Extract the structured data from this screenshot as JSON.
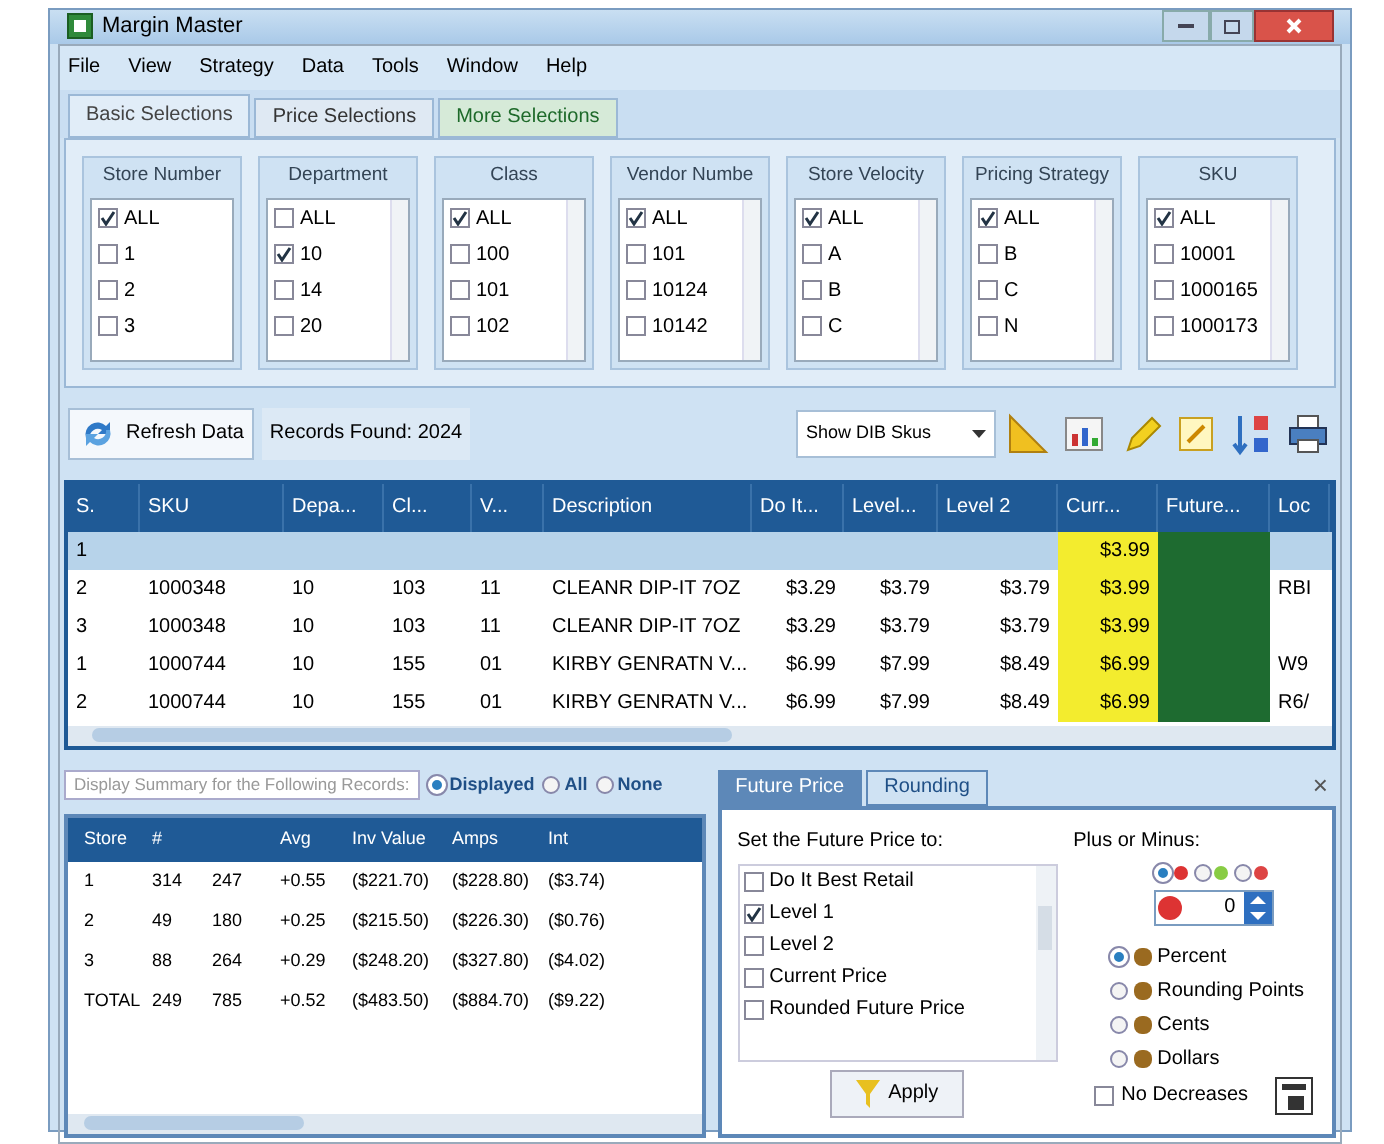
{
  "window": {
    "title": "Margin Master"
  },
  "menu": [
    "File",
    "View",
    "Strategy",
    "Data",
    "Tools",
    "Window",
    "Help"
  ],
  "tabs": [
    {
      "label": "Basic Selections",
      "selected": true
    },
    {
      "label": "Price Selections",
      "selected": false
    },
    {
      "label": "More Selections",
      "selected": false
    }
  ],
  "filters": [
    {
      "title": "Store Number",
      "items": [
        {
          "label": "ALL",
          "checked": true
        },
        {
          "label": "1",
          "checked": false
        },
        {
          "label": "2",
          "checked": false
        },
        {
          "label": "3",
          "checked": false
        }
      ]
    },
    {
      "title": "Department",
      "items": [
        {
          "label": "ALL",
          "checked": false
        },
        {
          "label": "10",
          "checked": true
        },
        {
          "label": "14",
          "checked": false
        },
        {
          "label": "20",
          "checked": false
        }
      ]
    },
    {
      "title": "Class",
      "items": [
        {
          "label": "ALL",
          "checked": true
        },
        {
          "label": "100",
          "checked": false
        },
        {
          "label": "101",
          "checked": false
        },
        {
          "label": "102",
          "checked": false
        }
      ]
    },
    {
      "title": "Vendor Numbe",
      "items": [
        {
          "label": "ALL",
          "checked": true
        },
        {
          "label": "101",
          "checked": false
        },
        {
          "label": "10124",
          "checked": false
        },
        {
          "label": "10142",
          "checked": false
        }
      ]
    },
    {
      "title": "Store Velocity",
      "items": [
        {
          "label": "ALL",
          "checked": true
        },
        {
          "label": "A",
          "checked": false
        },
        {
          "label": "B",
          "checked": false
        },
        {
          "label": "C",
          "checked": false
        }
      ]
    },
    {
      "title": "Pricing Strategy",
      "items": [
        {
          "label": "ALL",
          "checked": true
        },
        {
          "label": "B",
          "checked": false
        },
        {
          "label": "C",
          "checked": false
        },
        {
          "label": "N",
          "checked": false
        }
      ]
    },
    {
      "title": "SKU",
      "items": [
        {
          "label": "ALL",
          "checked": true
        },
        {
          "label": "10001",
          "checked": false
        },
        {
          "label": "1000165",
          "checked": false
        },
        {
          "label": "1000173",
          "checked": false
        }
      ]
    }
  ],
  "toolbar": {
    "refresh": "Refresh Data",
    "records": "Records Found: 2024",
    "dropdown": "Show DIB Skus"
  },
  "table": {
    "columns": [
      "S.",
      "SKU",
      "Depa...",
      "Cl...",
      "V...",
      "Description",
      "Do It...",
      "Level...",
      "Level 2",
      "Curr...",
      "Future...",
      "Loc"
    ],
    "rows": [
      {
        "selected": true,
        "cells": [
          "1",
          null,
          null,
          null,
          null,
          null,
          null,
          null,
          null,
          "$3.99",
          null,
          null
        ]
      },
      {
        "selected": false,
        "cells": [
          "2",
          "1000348",
          "10",
          "103",
          "11",
          "CLEANR DIP-IT 7OZ",
          "$3.29",
          "$3.79",
          "$3.79",
          "$3.99",
          null,
          "RBI"
        ]
      },
      {
        "selected": false,
        "cells": [
          "3",
          "1000348",
          "10",
          "103",
          "11",
          "CLEANR DIP-IT 7OZ",
          "$3.29",
          "$3.79",
          "$3.79",
          "$3.99",
          null,
          null
        ]
      },
      {
        "selected": false,
        "cells": [
          "1",
          "1000744",
          "10",
          "155",
          "01",
          "KIRBY GENRATN V...",
          "$6.99",
          "$7.99",
          "$8.49",
          "$6.99",
          null,
          "W9"
        ]
      },
      {
        "selected": false,
        "cells": [
          "2",
          "1000744",
          "10",
          "155",
          "01",
          "KIRBY GENRATN V...",
          "$6.99",
          "$7.99",
          "$8.49",
          "$6.99",
          null,
          "R6/"
        ]
      }
    ]
  },
  "summary": {
    "label": "Display Summary for the Following Records:",
    "options": [
      {
        "label": "Displayed",
        "selected": true
      },
      {
        "label": "All",
        "selected": false
      },
      {
        "label": "None",
        "selected": false
      }
    ],
    "columns": [
      "Store",
      "#",
      "",
      "Avg",
      "Inv Value",
      "Amps",
      "Int"
    ],
    "rows": [
      [
        "1",
        "314",
        "247",
        "+0.55",
        "($221.70)",
        "($228.80)",
        "($3.74)"
      ],
      [
        "2",
        "49",
        "180",
        "+0.25",
        "($215.50)",
        "($226.30)",
        "($0.76)"
      ],
      [
        "3",
        "88",
        "264",
        "+0.29",
        "($248.20)",
        "($327.80)",
        "($4.02)"
      ],
      [
        "TOTAL",
        "249",
        "785",
        "+0.52",
        "($483.50)",
        "($884.70)",
        "($9.22)"
      ]
    ]
  },
  "future": {
    "tabs": [
      {
        "label": "Future Price",
        "selected": true
      },
      {
        "label": "Rounding",
        "selected": false
      }
    ],
    "heading": "Set the Future Price to:",
    "items": [
      {
        "label": "Do It Best Retail",
        "checked": false
      },
      {
        "label": "Level 1",
        "checked": true
      },
      {
        "label": "Level 2",
        "checked": false
      },
      {
        "label": "Current Price",
        "checked": false
      },
      {
        "label": "Rounded Future Price",
        "checked": false
      }
    ],
    "apply": "Apply",
    "plus_minus": "Plus or Minus:",
    "signs": [
      {
        "selected": true
      },
      {
        "selected": false
      },
      {
        "selected": false
      }
    ],
    "amount": "0",
    "units": [
      {
        "label": "Percent",
        "selected": true
      },
      {
        "label": "Rounding Points",
        "selected": false
      },
      {
        "label": "Cents",
        "selected": false
      },
      {
        "label": "Dollars",
        "selected": false
      }
    ],
    "no_decreases": {
      "label": "No Decreases",
      "checked": false
    },
    "close": "×"
  }
}
